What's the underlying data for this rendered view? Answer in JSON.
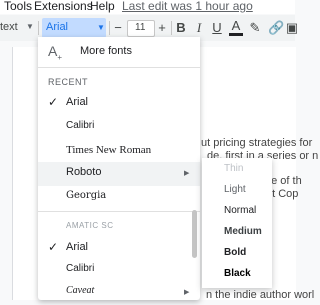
{
  "menubar": {
    "items": [
      "Tools",
      "Extensions",
      "Help"
    ],
    "last_edit": "Last edit was 1 hour ago"
  },
  "toolbar": {
    "style_value": "text",
    "font_value": "Arial",
    "font_size": "11",
    "minus_icon": "minus-icon",
    "plus_icon": "plus-icon",
    "bold": "B",
    "italic": "I",
    "underline": "U",
    "text_color": "A"
  },
  "font_menu": {
    "more_fonts": "More fonts",
    "recent_header": "RECENT",
    "recent": [
      {
        "label": "Arial",
        "checked": true,
        "has_submenu": false
      },
      {
        "label": "Calibri",
        "checked": false,
        "has_submenu": false
      },
      {
        "label": "Times New Roman",
        "checked": false,
        "has_submenu": false
      },
      {
        "label": "Roboto",
        "checked": false,
        "has_submenu": true
      },
      {
        "label": "Georgia",
        "checked": false,
        "has_submenu": false
      }
    ],
    "all_fonts": [
      {
        "label": "AMATIC SC",
        "checked": false,
        "has_submenu": false
      },
      {
        "label": "Arial",
        "checked": true,
        "has_submenu": false
      },
      {
        "label": "Calibri",
        "checked": false,
        "has_submenu": false
      },
      {
        "label": "Caveat",
        "checked": false,
        "has_submenu": true
      }
    ]
  },
  "weight_submenu": {
    "items": [
      "Thin",
      "Light",
      "Normal",
      "Medium",
      "Bold",
      "Black"
    ]
  },
  "document": {
    "line1": "ut pricing strategies for",
    "line2": "de, first in a series or n",
    "line3": "ne of th",
    "line4": "nt Cop",
    "line5": "n the indie author worl"
  },
  "colors": {
    "accent": "#1a73e8",
    "font_box_bg": "#c2dbff",
    "hover": "#f1f3f4"
  }
}
